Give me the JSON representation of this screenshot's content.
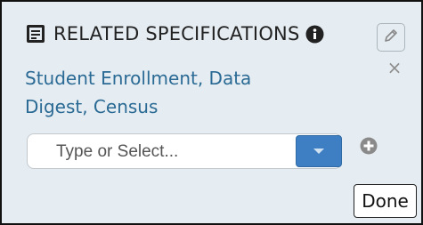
{
  "header": {
    "title": "RELATED SPECIFICATIONS",
    "doc_icon": "document-icon",
    "info_icon": "info-icon"
  },
  "edit_icon": "pencil-icon",
  "close_symbol": "×",
  "specifications": {
    "line1": "Student Enrollment, Data",
    "line2": "Digest, Census"
  },
  "select": {
    "placeholder": "Type or Select..."
  },
  "add_icon": "plus-circle-icon",
  "done_label": "Done",
  "colors": {
    "panel_bg": "#e6edf2",
    "link": "#2a6a94",
    "dropdown_button": "#3d7fc2"
  }
}
